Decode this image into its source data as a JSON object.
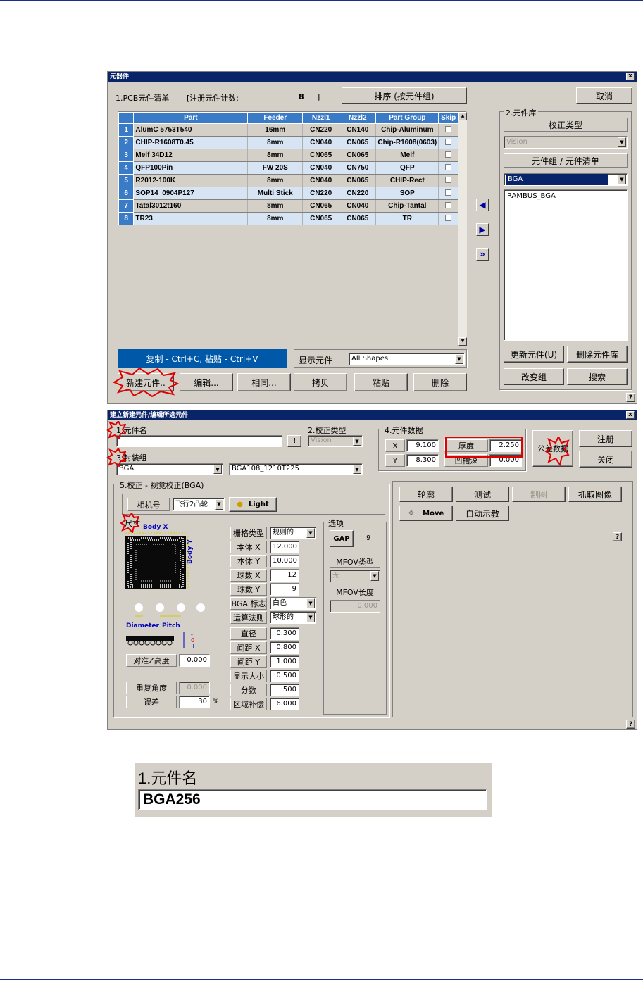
{
  "win1": {
    "title": "元器件",
    "close": "x",
    "list_label": "1.PCB元件清单",
    "count_label": "[注册元件计数:",
    "count_value": "8",
    "count_end": "]",
    "sort_button": "排序 (按元件组)",
    "cancel_button": "取消",
    "table": {
      "headers": [
        "Part",
        "Feeder",
        "Nzzl1",
        "Nzzl2",
        "Part Group",
        "Skip"
      ],
      "rows": [
        {
          "n": "1",
          "part": "AlumC 5753T540",
          "feeder": "16mm",
          "nz1": "CN220",
          "nz2": "CN140",
          "group": "Chip-Aluminum"
        },
        {
          "n": "2",
          "part": "CHIP-R1608T0.45",
          "feeder": "8mm",
          "nz1": "CN040",
          "nz2": "CN065",
          "group": "Chip-R1608(0603)"
        },
        {
          "n": "3",
          "part": "Melf 34D12",
          "feeder": "8mm",
          "nz1": "CN065",
          "nz2": "CN065",
          "group": "Melf"
        },
        {
          "n": "4",
          "part": "QFP100Pin",
          "feeder": "FW 20S",
          "nz1": "CN040",
          "nz2": "CN750",
          "group": "QFP"
        },
        {
          "n": "5",
          "part": "R2012-100K",
          "feeder": "8mm",
          "nz1": "CN040",
          "nz2": "CN065",
          "group": "CHIP-Rect"
        },
        {
          "n": "6",
          "part": "SOP14_0904P127",
          "feeder": "Multi Stick",
          "nz1": "CN220",
          "nz2": "CN220",
          "group": "SOP"
        },
        {
          "n": "7",
          "part": "Tatal3012t160",
          "feeder": "8mm",
          "nz1": "CN065",
          "nz2": "CN040",
          "group": "Chip-Tantal"
        },
        {
          "n": "8",
          "part": "TR23",
          "feeder": "8mm",
          "nz1": "CN065",
          "nz2": "CN065",
          "group": "TR"
        }
      ]
    },
    "copy_hint": "复制 - Ctrl+C, 粘贴 - Ctrl+V",
    "show_label": "显示元件",
    "show_value": "All Shapes",
    "buttons": {
      "new": "新建元件..",
      "edit": "编辑...",
      "same": "相同...",
      "copy": "拷贝",
      "paste": "粘贴",
      "delete": "删除"
    },
    "library": {
      "title": "2.元件库",
      "calib_label": "校正类型",
      "calib_value": "Vision",
      "group_label": "元件组 / 元件清单",
      "group_value": "BGA",
      "list": [
        "RAMBUS_BGA"
      ],
      "update": "更新元件(U)",
      "delete_lib": "删除元件库",
      "change_group": "改变组",
      "search": "搜索"
    },
    "help": "?"
  },
  "win2": {
    "title": "建立新建元件/编辑所选元件",
    "close": "x",
    "name_label": "1.元件名",
    "name_btn": "!",
    "calib_label": "2.校正类型",
    "calib_value": "Vision",
    "pkg_label": "3.封装组",
    "pkg_value": "BGA",
    "pkg_value2": "BGA108_1210T225",
    "data_label": "4.元件数据",
    "x_label": "X",
    "x_value": "9.100",
    "y_label": "Y",
    "y_value": "8.300",
    "thick_label": "厚度",
    "thick_value": "2.250",
    "dent_label": "凹槽深",
    "dent_value": "0.000",
    "tol_button": "公差数据",
    "register_button": "注册",
    "close_button": "关闭",
    "vision_label": "5.校正 - 视觉校正(BGA)",
    "camera_label": "相机号",
    "camera_value": "飞行2凸轮",
    "light_button": "Light",
    "size_label": "尺寸",
    "body_x": "Body X",
    "body_y": "Body Y",
    "diameter": "Diameter",
    "pitch": "Pitch",
    "z_label": "对准Z高度",
    "z_value": "0.000",
    "repeat_label": "重复角度",
    "repeat_value": "0.000",
    "err_label": "误差",
    "err_value": "30",
    "err_unit": "%",
    "params": [
      {
        "label": "栅格类型",
        "value": "规则的",
        "dropdown": true
      },
      {
        "label": "本体 X",
        "value": "12.000"
      },
      {
        "label": "本体 Y",
        "value": "10.000"
      },
      {
        "label": "球数 X",
        "value": "12"
      },
      {
        "label": "球数 Y",
        "value": "9"
      },
      {
        "label": "BGA 标志",
        "value": "白色",
        "dropdown": true
      },
      {
        "label": "运算法则",
        "value": "球形的",
        "dropdown": true
      }
    ],
    "params2": [
      {
        "label": "直径",
        "value": "0.300"
      },
      {
        "label": "间距 X",
        "value": "0.800"
      },
      {
        "label": "间距 Y",
        "value": "1.000"
      },
      {
        "label": "显示大小",
        "value": "0.500"
      },
      {
        "label": "分数",
        "value": "500"
      },
      {
        "label": "区域补偿",
        "value": "6.000"
      }
    ],
    "options_label": "选项",
    "gap_button": "GAP",
    "gap_value": "9",
    "mfov_type_label": "MFOV类型",
    "mfov_type_value": "无",
    "mfov_len_label": "MFOV长度",
    "mfov_len_value": "0.000",
    "buttons": {
      "outline": "轮廓",
      "test": "测试",
      "draw": "制图",
      "grab": "抓取图像",
      "move": "Move",
      "auto": "自动示教"
    },
    "help": "?"
  },
  "zoom": {
    "label": "1.元件名",
    "value": "BGA256"
  }
}
